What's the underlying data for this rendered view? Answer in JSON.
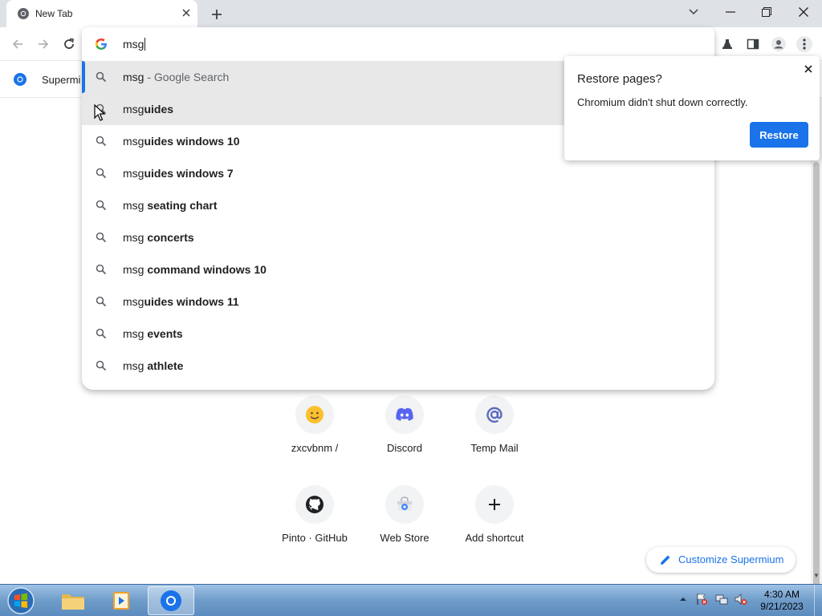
{
  "browser": {
    "tab_title": "New Tab",
    "omnibox_text": "msg",
    "bookmark_label": "Supermi"
  },
  "suggestions": [
    {
      "prefix": "msg",
      "bold": "",
      "sub": " - Google Search"
    },
    {
      "prefix": "msg",
      "bold": "uides",
      "sub": ""
    },
    {
      "prefix": "msg",
      "bold": "uides windows 10",
      "sub": ""
    },
    {
      "prefix": "msg",
      "bold": "uides windows 7",
      "sub": ""
    },
    {
      "prefix": "msg ",
      "bold": "seating chart",
      "sub": ""
    },
    {
      "prefix": "msg ",
      "bold": "concerts",
      "sub": ""
    },
    {
      "prefix": "msg ",
      "bold": "command windows 10",
      "sub": ""
    },
    {
      "prefix": "msg",
      "bold": "uides windows 11",
      "sub": ""
    },
    {
      "prefix": "msg ",
      "bold": "events",
      "sub": ""
    },
    {
      "prefix": "msg ",
      "bold": "athlete",
      "sub": ""
    }
  ],
  "restore_popup": {
    "title": "Restore pages?",
    "message": "Chromium didn't shut down correctly.",
    "button": "Restore"
  },
  "shortcuts": [
    {
      "label": "zxcvbnm /",
      "icon": "smiley-icon"
    },
    {
      "label": "Discord",
      "icon": "discord-icon"
    },
    {
      "label": "Temp Mail",
      "icon": "at-sign-icon"
    },
    {
      "label": "Pinto · GitHub",
      "icon": "github-icon"
    },
    {
      "label": "Web Store",
      "icon": "web-store-icon"
    },
    {
      "label": "Add shortcut",
      "icon": "plus-icon"
    }
  ],
  "customize_label": "Customize Supermium",
  "taskbar": {
    "time": "4:30 AM",
    "date": "9/21/2023"
  },
  "colors": {
    "accent": "#1a73e8",
    "highlight_row": "#e8e8e8"
  }
}
